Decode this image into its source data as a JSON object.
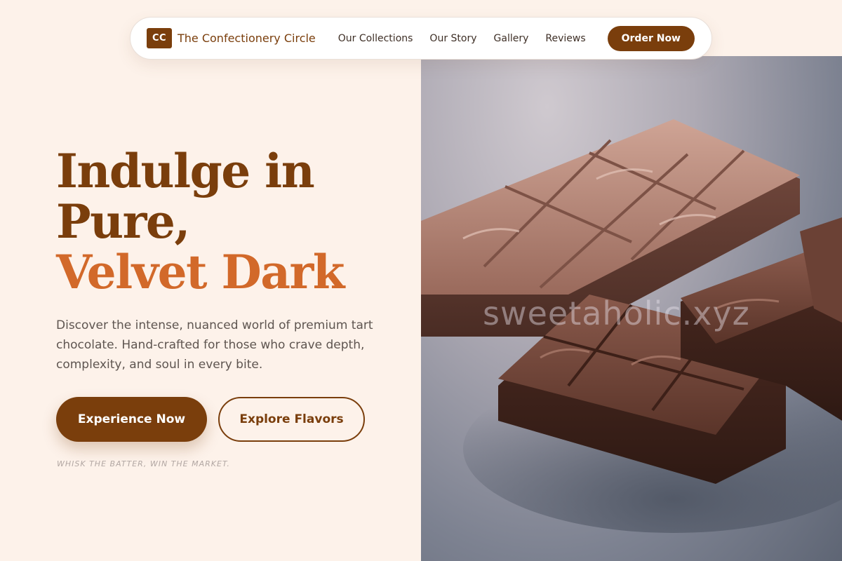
{
  "nav": {
    "logo_initials": "CC",
    "brand_name": "The Confectionery Circle",
    "links": [
      {
        "label": "Our Collections"
      },
      {
        "label": "Our Story"
      },
      {
        "label": "Gallery"
      },
      {
        "label": "Reviews"
      }
    ],
    "cta_label": "Order Now"
  },
  "hero": {
    "headline_line1": "Indulge in",
    "headline_line2": "Pure,",
    "headline_accent": "Velvet Dark",
    "description": "Discover the intense, nuanced world of premium tart chocolate. Hand-crafted for those who crave depth, complexity, and soul in every bite.",
    "primary_button": "Experience Now",
    "secondary_button": "Explore Flavors",
    "tagline": "WHISK THE BATTER, WIN THE MARKET."
  },
  "image": {
    "watermark": "sweetaholic.xyz",
    "subject": "chocolate-bars-photo"
  },
  "colors": {
    "background": "#fdf2ea",
    "brand_brown": "#7a3e0c",
    "accent_orange": "#d2692a",
    "body_text": "#5e5550"
  }
}
